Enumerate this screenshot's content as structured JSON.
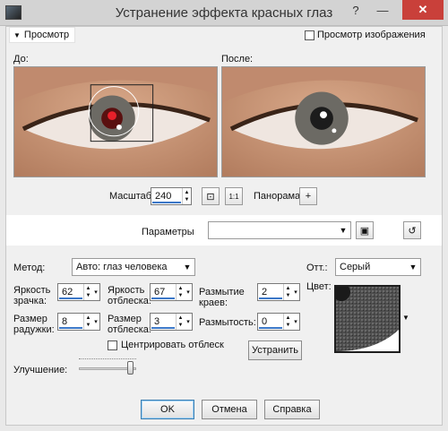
{
  "window": {
    "title": "Устранение эффекта красных глаз",
    "help": "?",
    "minimize": "—",
    "close": "✕"
  },
  "preview": {
    "toggle_label": "Просмотр",
    "toggle_arrow": "▼",
    "show_image_label": "Просмотр изображения"
  },
  "panes": {
    "before_label": "До:",
    "after_label": "После:"
  },
  "zoom": {
    "label": "Масштаб:",
    "value": "240",
    "pan_label": "Панорама:",
    "pan_icon": "+"
  },
  "presets": {
    "label": "Параметры",
    "value": ""
  },
  "method": {
    "label": "Метод:",
    "value": "Авто: глаз человека"
  },
  "tone": {
    "label": "Отт.:",
    "value": "Серый"
  },
  "color": {
    "label": "Цвет:"
  },
  "params": {
    "pupil_brightness": {
      "label_line1": "Яркость",
      "label_line2": "зрачка:",
      "value": "62"
    },
    "glint_brightness": {
      "label_line1": "Яркость",
      "label_line2": "отблеска:",
      "value": "67"
    },
    "edge_blur": {
      "label_line1": "Размытие",
      "label_line2": "краев:",
      "value": "2"
    },
    "iris_size": {
      "label_line1": "Размер",
      "label_line2": "радужки:",
      "value": "8"
    },
    "glint_size": {
      "label_line1": "Размер",
      "label_line2": "отблеска:",
      "value": "3"
    },
    "feather": {
      "label": "Размытость:",
      "value": "0"
    }
  },
  "center_glint_label": "Центрировать отблеск",
  "apply_label": "Устранить",
  "enhance": {
    "label": "Улучшение:",
    "level": 0.95
  },
  "footer": {
    "ok": "OK",
    "cancel": "Отмена",
    "help": "Справка"
  },
  "colors": {
    "accent": "#3c78c8",
    "close": "#c9403a",
    "titlebar": "#d3d3d3"
  }
}
